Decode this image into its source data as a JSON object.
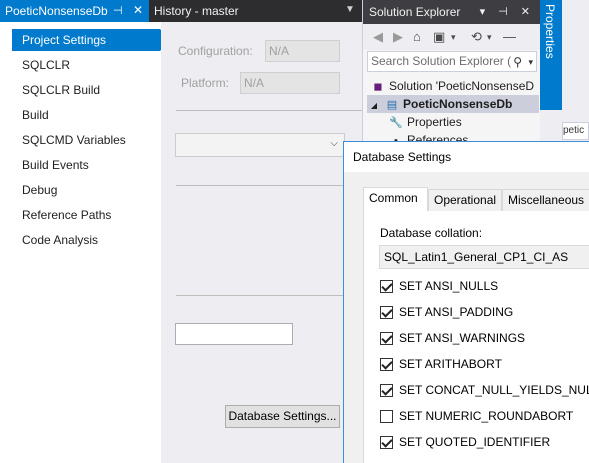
{
  "doc_tabs": {
    "active": {
      "label": "PoeticNonsenseDb",
      "pin": "⊣",
      "close": "✕"
    },
    "history": {
      "label": "History - master"
    },
    "overflow": "▼"
  },
  "nav": {
    "items": [
      {
        "label": "Project Settings",
        "active": true
      },
      {
        "label": "SQLCLR"
      },
      {
        "label": "SQLCLR Build"
      },
      {
        "label": "Build"
      },
      {
        "label": "SQLCMD Variables"
      },
      {
        "label": "Build Events"
      },
      {
        "label": "Debug"
      },
      {
        "label": "Reference Paths"
      },
      {
        "label": "Code Analysis"
      }
    ]
  },
  "main": {
    "configuration_label": "Configuration:",
    "configuration_value": "N/A",
    "platform_label": "Platform:",
    "platform_value": "N/A",
    "combo_chevron": "⌵",
    "db_settings_button": "Database Settings..."
  },
  "solution_explorer": {
    "title": "Solution Explorer",
    "title_buttons": "▾ ⊣ ✕",
    "search_placeholder": "Search Solution Explorer (",
    "search_icon": "⚲",
    "search_dropdown": "▾",
    "tree": {
      "solution": "Solution 'PoeticNonsenseD",
      "project": "PoeticNonsenseDb",
      "properties": "Properties",
      "references": "References"
    }
  },
  "properties_tab": {
    "label": "Properties"
  },
  "right_sliver": "petic",
  "dialog": {
    "title": "Database Settings",
    "tabs": [
      {
        "label": "Common",
        "active": true
      },
      {
        "label": "Operational"
      },
      {
        "label": "Miscellaneous"
      }
    ],
    "collation_label": "Database collation:",
    "collation_value": "SQL_Latin1_General_CP1_CI_AS",
    "options": [
      {
        "label": "SET ANSI_NULLS",
        "checked": true
      },
      {
        "label": "SET ANSI_PADDING",
        "checked": true
      },
      {
        "label": "SET ANSI_WARNINGS",
        "checked": true
      },
      {
        "label": "SET ARITHABORT",
        "checked": true
      },
      {
        "label": "SET CONCAT_NULL_YIELDS_NULL",
        "checked": true
      },
      {
        "label": "SET NUMERIC_ROUNDABORT",
        "checked": false
      },
      {
        "label": "SET QUOTED_IDENTIFIER",
        "checked": true
      }
    ]
  },
  "colors": {
    "accent": "#007acc",
    "tab_strip": "#2d2d30",
    "panel": "#eeeef2"
  }
}
